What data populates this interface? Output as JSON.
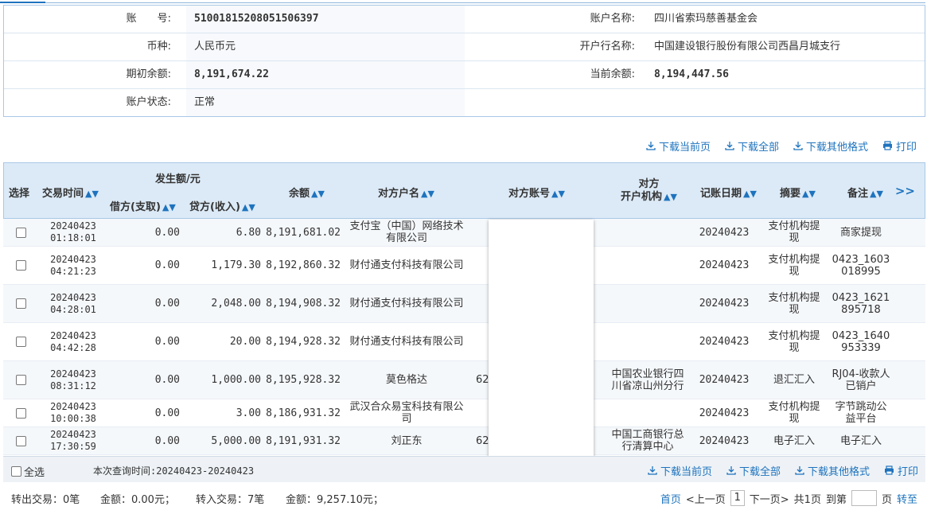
{
  "account": {
    "no_label": "账　　号:",
    "no": "51001815208051506397",
    "name_label": "账户名称:",
    "name": "四川省索玛慈善基金会",
    "currency_label": "币种:",
    "currency": "人民币元",
    "bank_label": "开户行名称:",
    "bank": "中国建设银行股份有限公司西昌月城支行",
    "opening_label": "期初余额:",
    "opening": "8,191,674.22",
    "current_label": "当前余额:",
    "current": "8,194,447.56",
    "status_label": "账户状态:",
    "status": "正常"
  },
  "toolbar": {
    "download_page": "下载当前页",
    "download_all": "下载全部",
    "download_other": "下载其他格式",
    "print": "打印"
  },
  "table": {
    "headers": {
      "select": "选择",
      "time": "交易时间",
      "amount_group": "发生额/元",
      "debit": "借方(支取)",
      "credit": "贷方(收入)",
      "balance": "余额",
      "party_name": "对方户名",
      "party_account": "对方账号",
      "party_bank_l1": "对方",
      "party_bank_l2": "开户机构",
      "post_date": "记账日期",
      "summary": "摘要",
      "remark": "备注",
      "more": ">>"
    },
    "rows": [
      {
        "date": "20240423",
        "time": "01:18:01",
        "debit": "0.00",
        "credit": "6.80",
        "balance": "8,191,681.02",
        "party": "支付宝（中国）网络技术有限公司",
        "account": "",
        "bank": "",
        "post": "20240423",
        "summary": "支付机构提现",
        "remark": "商家提现"
      },
      {
        "date": "20240423",
        "time": "04:21:23",
        "debit": "0.00",
        "credit": "1,179.30",
        "balance": "8,192,860.32",
        "party": "财付通支付科技有限公司",
        "account": "",
        "bank": "",
        "post": "20240423",
        "summary": "支付机构提现",
        "remark": "0423_1603018995"
      },
      {
        "date": "20240423",
        "time": "04:28:01",
        "debit": "0.00",
        "credit": "2,048.00",
        "balance": "8,194,908.32",
        "party": "财付通支付科技有限公司",
        "account": "",
        "bank": "",
        "post": "20240423",
        "summary": "支付机构提现",
        "remark": "0423_1621895718"
      },
      {
        "date": "20240423",
        "time": "04:42:28",
        "debit": "0.00",
        "credit": "20.00",
        "balance": "8,194,928.32",
        "party": "财付通支付科技有限公司",
        "account": "",
        "bank": "",
        "post": "20240423",
        "summary": "支付机构提现",
        "remark": "0423_1640953339"
      },
      {
        "date": "20240423",
        "time": "08:31:12",
        "debit": "0.00",
        "credit": "1,000.00",
        "balance": "8,195,928.32",
        "party": "莫色格达",
        "account": "62",
        "bank": "中国农业银行四川省凉山州分行",
        "post": "20240423",
        "summary": "退汇汇入",
        "remark": "RJ04-收款人已销户"
      },
      {
        "date": "20240423",
        "time": "10:00:38",
        "debit": "0.00",
        "credit": "3.00",
        "balance": "8,186,931.32",
        "party": "武汉合众易宝科技有限公司",
        "account": "",
        "bank": "",
        "post": "20240423",
        "summary": "支付机构提现",
        "remark": "字节跳动公益平台"
      },
      {
        "date": "20240423",
        "time": "17:30:59",
        "debit": "0.00",
        "credit": "5,000.00",
        "balance": "8,191,931.32",
        "party": "刘正东",
        "account": "62",
        "bank": "中国工商银行总行清算中心",
        "post": "20240423",
        "summary": "电子汇入",
        "remark": "电子汇入"
      }
    ]
  },
  "footer": {
    "select_all": "全选",
    "query_time": "本次查询时间:20240423-20240423",
    "out_tx": "转出交易：0笔",
    "out_amt": "金额：0.00元；",
    "in_tx": "转入交易：7笔",
    "in_amt": "金额：9,257.10元；",
    "first": "首页",
    "prev": "<上一页",
    "page": "1",
    "next": "下一页>",
    "total": "共1页",
    "goto_label": "到第",
    "page_unit": "页",
    "goto_btn": "转至"
  },
  "colors": {
    "accent": "#1e73be",
    "header_bg": "#dceaf7",
    "border": "#a9c8e6"
  }
}
